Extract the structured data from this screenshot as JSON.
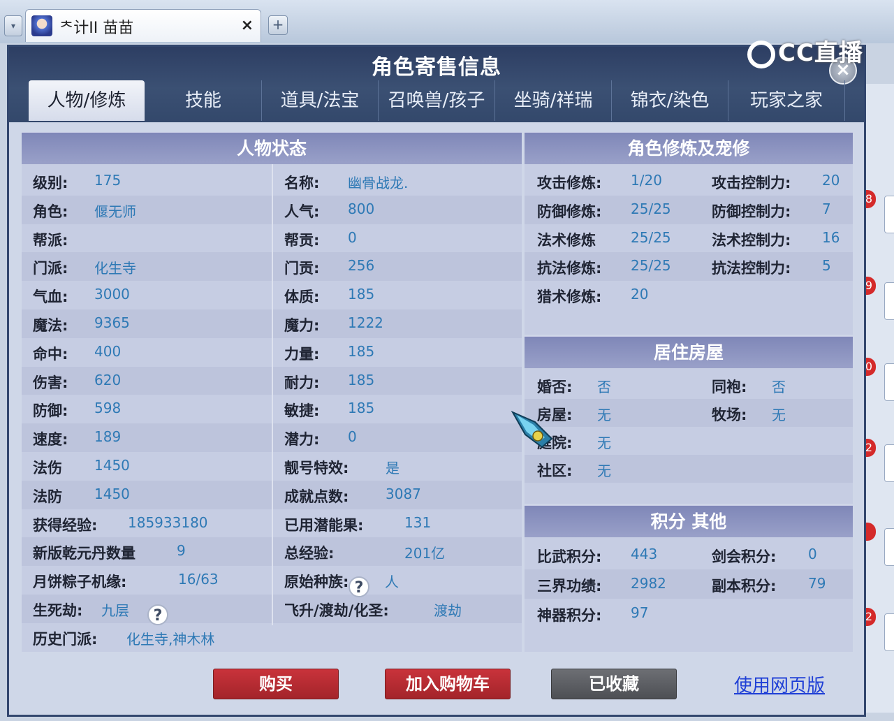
{
  "browser": {
    "tab_title": "ᄎ计II 苗苗",
    "tab_close": "×",
    "new_tab": "+",
    "menu": "▾"
  },
  "watermark": "CC直播",
  "dialog": {
    "title": "角色寄售信息",
    "close": "×",
    "tabs": [
      "人物/修炼",
      "技能",
      "道具/法宝",
      "召唤兽/孩子",
      "坐骑/祥瑞",
      "锦衣/染色",
      "玩家之家"
    ],
    "active_tab": 0
  },
  "status": {
    "header": "人物状态",
    "rows": [
      {
        "l1": "级别:",
        "v1": "175",
        "l2": "名称:",
        "v2": "幽骨战龙."
      },
      {
        "l1": "角色:",
        "v1": "偃无师",
        "l2": "人气:",
        "v2": "800"
      },
      {
        "l1": "帮派:",
        "v1": "",
        "l2": "帮贡:",
        "v2": "0"
      },
      {
        "l1": "门派:",
        "v1": "化生寺",
        "l2": "门贡:",
        "v2": "256"
      },
      {
        "l1": "气血:",
        "v1": "3000",
        "l2": "体质:",
        "v2": "185"
      },
      {
        "l1": "魔法:",
        "v1": "9365",
        "l2": "魔力:",
        "v2": "1222"
      },
      {
        "l1": "命中:",
        "v1": "400",
        "l2": "力量:",
        "v2": "185"
      },
      {
        "l1": "伤害:",
        "v1": "620",
        "l2": "耐力:",
        "v2": "185"
      },
      {
        "l1": "防御:",
        "v1": "598",
        "l2": "敏捷:",
        "v2": "185"
      },
      {
        "l1": "速度:",
        "v1": "189",
        "l2": "潜力:",
        "v2": "0"
      },
      {
        "l1": "法伤",
        "v1": "1450",
        "l2": "靓号特效:",
        "v2": "是"
      },
      {
        "l1": "法防",
        "v1": "1450",
        "l2": "成就点数:",
        "v2": "3087"
      },
      {
        "l1": "获得经验:",
        "v1": "185933180",
        "l2": "已用潜能果:",
        "v2": "131"
      },
      {
        "l1": "新版乾元丹数量",
        "v1": "9",
        "l2": "总经验:",
        "v2": "201亿"
      },
      {
        "l1": "月饼粽子机缘:",
        "v1": "16/63",
        "l2": "原始种族:",
        "v2": "人"
      },
      {
        "l1": "生死劫:",
        "v1": "九层",
        "l2": "飞升/渡劫/化圣:",
        "v2": "渡劫"
      },
      {
        "l1": "历史门派:",
        "v1": "化生寺,神木林",
        "l2": "",
        "v2": ""
      }
    ],
    "help_glyph": "?"
  },
  "cultivation": {
    "header": "角色修炼及宠修",
    "rows": [
      {
        "l1": "攻击修炼:",
        "v1": "1/20",
        "l2": "攻击控制力:",
        "v2": "20"
      },
      {
        "l1": "防御修炼:",
        "v1": "25/25",
        "l2": "防御控制力:",
        "v2": "7"
      },
      {
        "l1": "法术修炼",
        "v1": "25/25",
        "l2": "法术控制力:",
        "v2": "16"
      },
      {
        "l1": "抗法修炼:",
        "v1": "25/25",
        "l2": "抗法控制力:",
        "v2": "5"
      },
      {
        "l1": "猎术修炼:",
        "v1": "20",
        "l2": "",
        "v2": ""
      }
    ]
  },
  "housing": {
    "header": "居住房屋",
    "rows": [
      {
        "l1": "婚否:",
        "v1": "否",
        "l2": "同袍:",
        "v2": "否"
      },
      {
        "l1": "房屋:",
        "v1": "无",
        "l2": "牧场:",
        "v2": "无"
      },
      {
        "l1": "庭院:",
        "v1": "无",
        "l2": "",
        "v2": ""
      },
      {
        "l1": "社区:",
        "v1": "无",
        "l2": "",
        "v2": ""
      }
    ]
  },
  "points": {
    "header": "积分 其他",
    "rows": [
      {
        "l1": "比武积分:",
        "v1": "443",
        "l2": "剑会积分:",
        "v2": "0"
      },
      {
        "l1": "三界功绩:",
        "v1": "2982",
        "l2": "副本积分:",
        "v2": "79"
      },
      {
        "l1": "神器积分:",
        "v1": "97",
        "l2": "",
        "v2": ""
      }
    ]
  },
  "actions": {
    "buy": "购买",
    "add_cart": "加入购物车",
    "favorited": "已收藏",
    "web_version": "使用网页版"
  },
  "background_badges": [
    "8",
    "9",
    "0",
    "2",
    "",
    "2"
  ],
  "colors": {
    "header_dark": "#33476e",
    "panel_header": "#8e95c1",
    "value_blue": "#2e79b5",
    "button_red": "#b52b31",
    "button_gray": "#5d5f64",
    "link_blue": "#1f3fd6"
  }
}
